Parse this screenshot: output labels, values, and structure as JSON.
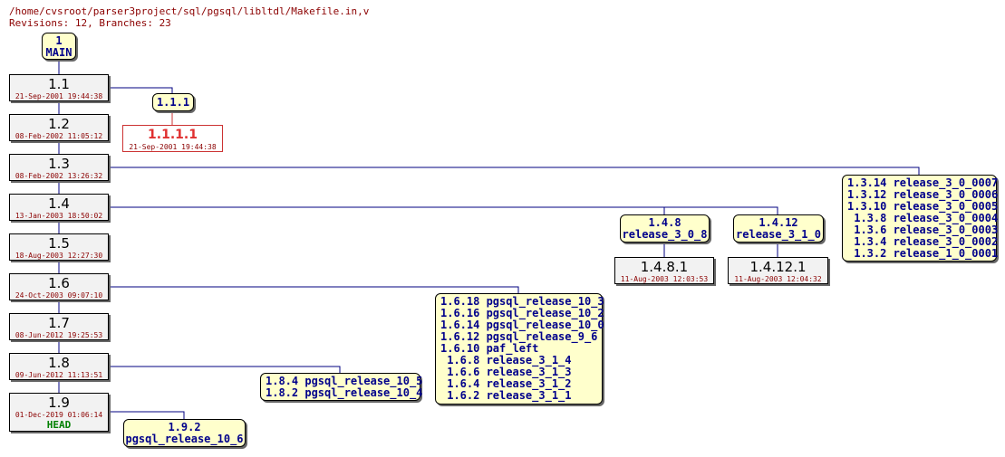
{
  "header": {
    "path": "/home/cvsroot/parser3project/sql/pgsql/libltdl/Makefile.in,v",
    "summary": "Revisions: 12, Branches: 23"
  },
  "root": {
    "number": "1",
    "name": "MAIN"
  },
  "trunk": [
    {
      "rev": "1.1",
      "date": "21-Sep-2001 19:44:38"
    },
    {
      "rev": "1.2",
      "date": "08-Feb-2002 11:05:12"
    },
    {
      "rev": "1.3",
      "date": "08-Feb-2002 13:26:32"
    },
    {
      "rev": "1.4",
      "date": "13-Jan-2003 18:50:02"
    },
    {
      "rev": "1.5",
      "date": "18-Aug-2003 12:27:30"
    },
    {
      "rev": "1.6",
      "date": "24-Oct-2003 09:07:10"
    },
    {
      "rev": "1.7",
      "date": "08-Jun-2012 19:25:53"
    },
    {
      "rev": "1.8",
      "date": "09-Jun-2012 11:13:51"
    },
    {
      "rev": "1.9",
      "date": "01-Dec-2019 01:06:14",
      "tag": "HEAD"
    }
  ],
  "branches": {
    "b_1_1_1": {
      "lines": [
        "1.1.1"
      ]
    },
    "b_1_3": {
      "lines": [
        "1.3.14 release_3_0_0007",
        "1.3.12 release_3_0_0006",
        "1.3.10 release_3_0_0005",
        " 1.3.8 release_3_0_0004",
        " 1.3.6 release_3_0_0003",
        " 1.3.4 release_3_0_0002",
        " 1.3.2 release_1_0_0001"
      ]
    },
    "b_1_4_8": {
      "lines": [
        "1.4.8",
        "release_3_0_8"
      ]
    },
    "b_1_4_12": {
      "lines": [
        "1.4.12",
        "release_3_1_0"
      ]
    },
    "b_1_6": {
      "lines": [
        "1.6.18 pgsql_release_10_3",
        "1.6.16 pgsql_release_10_2",
        "1.6.14 pgsql_release_10_0",
        "1.6.12 pgsql_release_9_6",
        "1.6.10 paf_left",
        " 1.6.8 release_3_1_4",
        " 1.6.6 release_3_1_3",
        " 1.6.4 release_3_1_2",
        " 1.6.2 release_3_1_1"
      ]
    },
    "b_1_8": {
      "lines": [
        "1.8.4 pgsql_release_10_5",
        "1.8.2 pgsql_release_10_4"
      ]
    },
    "b_1_9": {
      "lines": [
        "1.9.2",
        "pgsql_release_10_6"
      ]
    }
  },
  "branch_revs": [
    {
      "rev": "1.1.1.1",
      "date": "21-Sep-2001 19:44:38",
      "dead": true
    },
    {
      "rev": "1.4.8.1",
      "date": "11-Aug-2003 12:03:53"
    },
    {
      "rev": "1.4.12.1",
      "date": "11-Aug-2003 12:04:32"
    }
  ],
  "colors": {
    "line": "#000080",
    "tag_bg": "#ffffcc",
    "tag_text": "#00008b",
    "date": "#8b0000",
    "head": "#008000",
    "dead": "#e03030"
  }
}
